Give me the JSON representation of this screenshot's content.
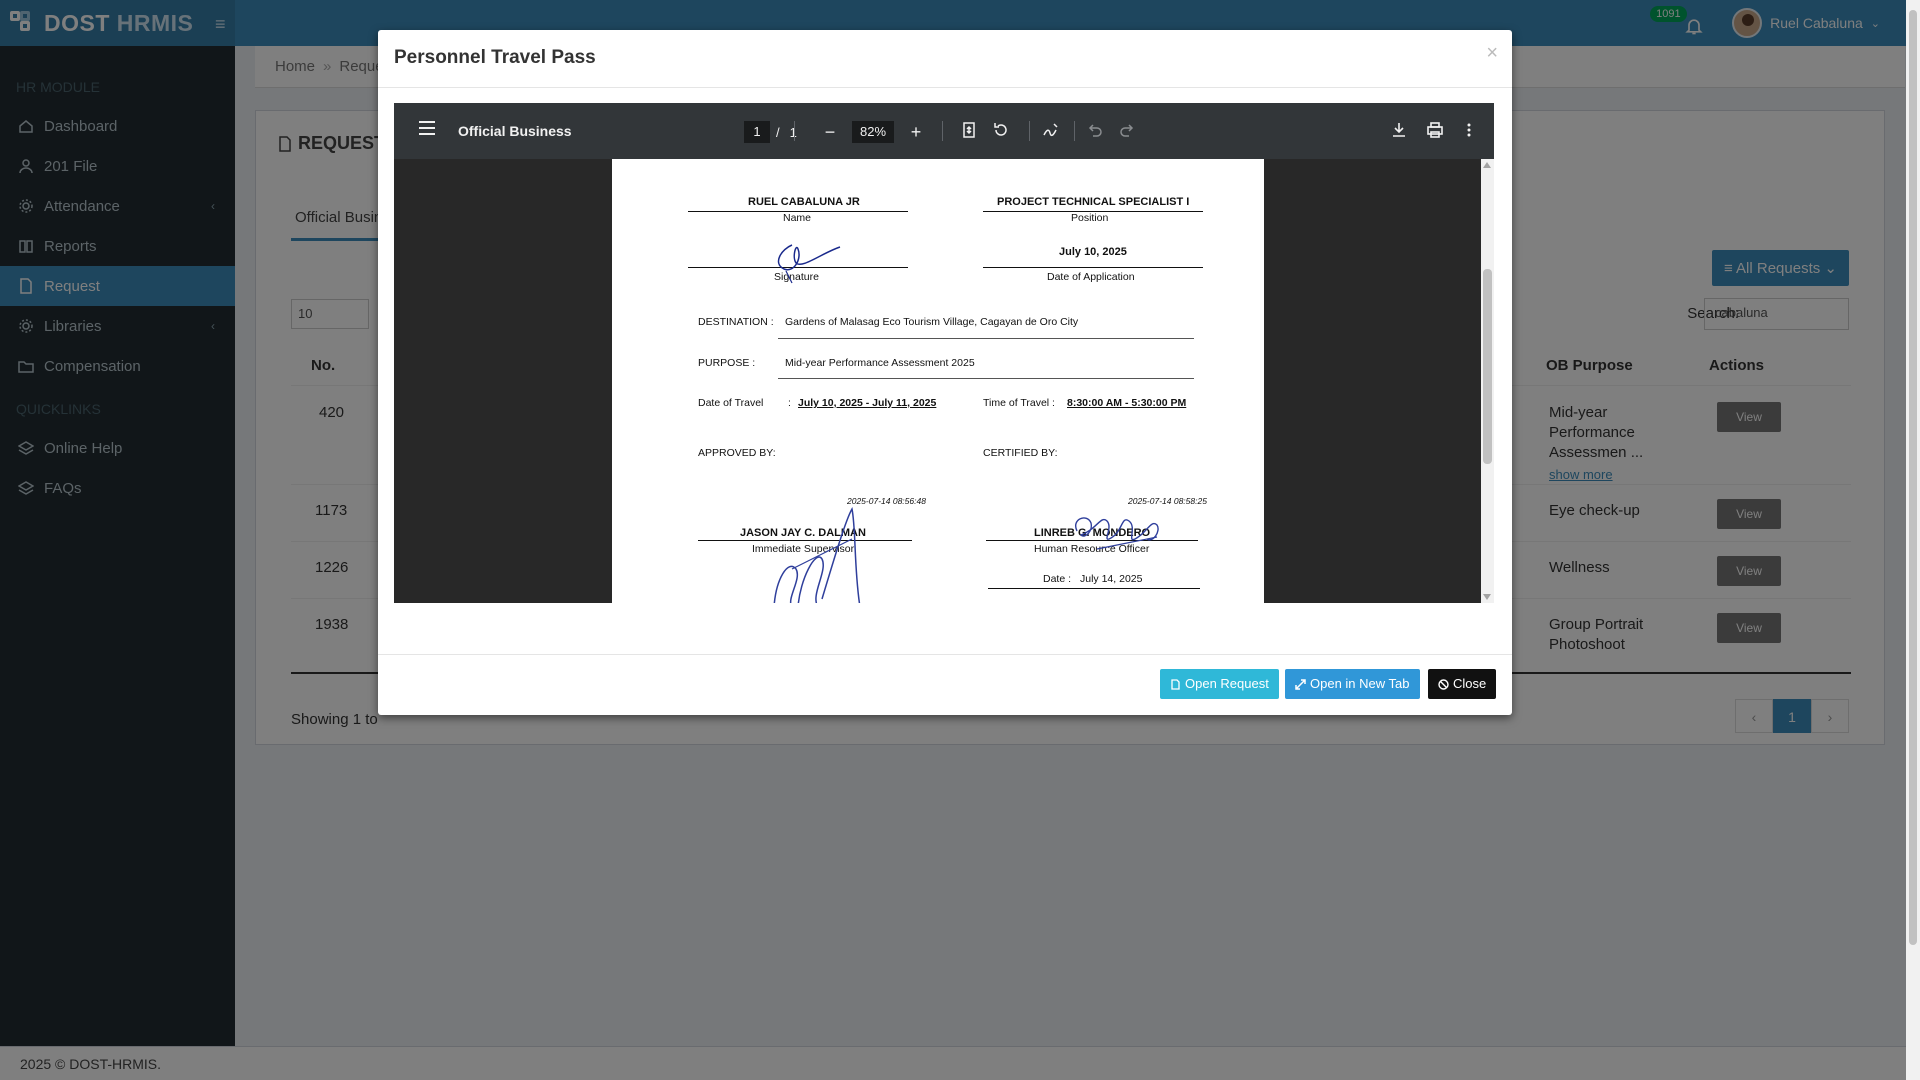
{
  "app": {
    "brand_primary": "DOST",
    "brand_secondary": " HRMIS",
    "notifications_count": "1091",
    "user_name": "Ruel Cabaluna"
  },
  "sidebar": {
    "header": "HR MODULE",
    "items": [
      {
        "label": "Dashboard"
      },
      {
        "label": "201 File"
      },
      {
        "label": "Attendance"
      },
      {
        "label": "Reports"
      },
      {
        "label": "Request"
      },
      {
        "label": "Libraries"
      },
      {
        "label": "Compensation"
      }
    ],
    "quicklinks_header": "QUICKLINKS",
    "quicklinks": [
      {
        "label": "Online Help"
      },
      {
        "label": "FAQs"
      }
    ]
  },
  "breadcrumb": {
    "home": "Home",
    "current": "Requests"
  },
  "request_box": {
    "title": "REQUEST",
    "tab": "Official Busin",
    "all_requests": "All Requests",
    "page_length": "10",
    "search_label": "Search:",
    "search_value": "cabaluna",
    "columns": {
      "no": "No.",
      "purpose": "OB Purpose",
      "actions": "Actions"
    },
    "rows": [
      {
        "no": "420",
        "purpose": "Mid-year Performance Assessmen ...",
        "show_more": "show more",
        "action": "View"
      },
      {
        "no": "1173",
        "purpose": "Eye check-up",
        "action": "View"
      },
      {
        "no": "1226",
        "purpose": "Wellness",
        "action": "View"
      },
      {
        "no": "1938",
        "purpose": "Group Portrait Photoshoot",
        "action": "View"
      }
    ],
    "showing": "Showing 1 to",
    "pager": {
      "prev": "‹",
      "current": "1",
      "next": "›"
    }
  },
  "footer": "2025 © DOST-HRMIS.",
  "modal": {
    "title": "Personnel Travel Pass",
    "close_symbol": "×",
    "buttons": {
      "open_request": "Open Request",
      "open_new_tab": "Open in New Tab",
      "close": "Close"
    },
    "colors": {
      "open_request": "#2fb8d8",
      "open_new_tab": "#3097d8",
      "close": "#111111"
    }
  },
  "pdf_viewer": {
    "doc_title": "Official Business",
    "page_current": "1",
    "page_sep": "/",
    "page_total": "1",
    "zoom": "82%",
    "zoom_out": "−",
    "zoom_in": "+"
  },
  "document": {
    "name": "RUEL  CABALUNA JR",
    "name_label": "Name",
    "position": "PROJECT TECHNICAL SPECIALIST I",
    "position_label": "Position",
    "signature_label": "Signature",
    "date_of_application": "July 10, 2025",
    "date_of_application_label": "Date of Application",
    "destination_label": "DESTINATION :",
    "destination": "Gardens of Malasag Eco Tourism Village, Cagayan de Oro City",
    "purpose_label": "PURPOSE :",
    "purpose": "Mid-year Performance Assessment 2025",
    "date_of_travel_label": "Date of Travel",
    "date_of_travel": "July 10, 2025 - July 11, 2025",
    "time_of_travel_label": "Time of Travel :",
    "time_of_travel": "8:30:00 AM - 5:30:00 PM",
    "approved_by_label": "APPROVED BY:",
    "certified_by_label": "CERTIFIED BY:",
    "approver_timestamp": "2025-07-14 08:56:48",
    "approver_name": "JASON JAY C. DALMAN",
    "approver_title": "Immediate Supervisor",
    "certifier_timestamp": "2025-07-14 08:58:25",
    "certifier_name": "LINREB G. MONDERO",
    "certifier_title": "Human Resource Officer",
    "certified_date_label": "Date :",
    "certified_date": "July 14, 2025"
  }
}
